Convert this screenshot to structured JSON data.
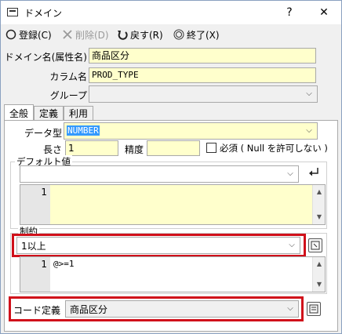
{
  "window": {
    "title": "ドメイン",
    "help_glyph": "?",
    "close_glyph": "✕"
  },
  "toolbar": {
    "register": "登録(C)",
    "delete": "削除(D)",
    "back": "戻す(R)",
    "finish": "終了(X)"
  },
  "form": {
    "domain_label": "ドメイン名(属性名)",
    "domain_value": "商品区分",
    "column_label": "カラム名",
    "column_value": "PROD_TYPE",
    "group_label": "グループ",
    "group_value": ""
  },
  "tabs": [
    "全般",
    "定義",
    "利用"
  ],
  "general": {
    "datatype_label": "データ型",
    "datatype_value": "NUMBER",
    "length_label": "長さ",
    "length_value": "1",
    "precision_label": "精度",
    "precision_value": "",
    "required_label": "必須 ( Null を許可しない )",
    "default_label": "デフォルト値",
    "default_value": "",
    "default_line_no": "1",
    "constraint_label": "制約",
    "constraint_value": "1以上",
    "constraint_line_no": "1",
    "constraint_code": "@>=1",
    "code_def_label": "コード定義",
    "code_def_value": "商品区分"
  }
}
